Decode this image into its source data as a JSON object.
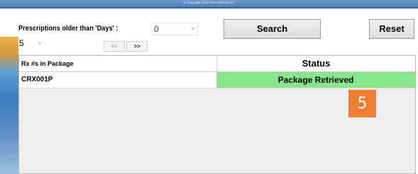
{
  "header": {
    "copyright": "© Copyright 2016 Prescriptional Inc."
  },
  "filters": {
    "older_than_label": "Prescriptions older than 'Days' :",
    "days_value": "0",
    "search_label": "Search",
    "reset_label": "Reset",
    "page_value": "5",
    "prev_label": "<<",
    "next_label": ">>"
  },
  "table": {
    "columns": [
      "Rx #s in Package",
      "Status"
    ],
    "rows": [
      {
        "rx": "CRX001P",
        "status": "Package Retrieved"
      }
    ]
  },
  "annotation": {
    "step": "5"
  },
  "colors": {
    "status_success": "#87e68a",
    "badge": "#ef7d32"
  }
}
